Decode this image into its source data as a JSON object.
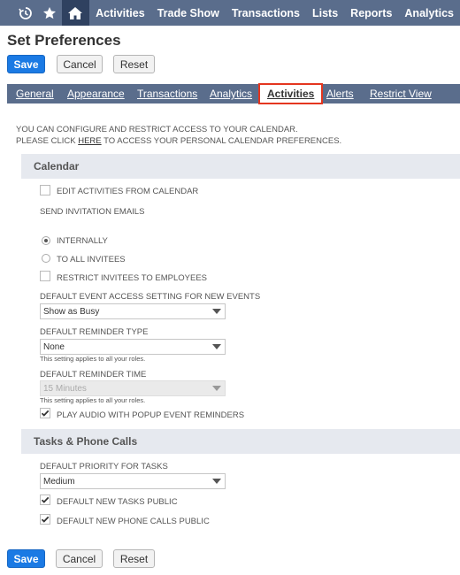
{
  "topnav": {
    "items": [
      "Activities",
      "Trade Show",
      "Transactions",
      "Lists",
      "Reports",
      "Analytics"
    ],
    "icons": [
      "history-icon",
      "star-icon",
      "home-icon"
    ]
  },
  "page": {
    "title": "Set Preferences"
  },
  "buttons": {
    "save": "Save",
    "cancel": "Cancel",
    "reset": "Reset"
  },
  "subtabs": [
    "General",
    "Appearance",
    "Transactions",
    "Analytics",
    "Activities",
    "Alerts",
    "Restrict View"
  ],
  "active_subtab": "Activities",
  "intro": {
    "line1": "YOU CAN CONFIGURE AND RESTRICT ACCESS TO YOUR CALENDAR.",
    "line2_pre": "PLEASE CLICK ",
    "line2_link": "HERE",
    "line2_post": " TO ACCESS YOUR PERSONAL CALENDAR PREFERENCES."
  },
  "calendar": {
    "header": "Calendar",
    "edit_activities": {
      "label": "EDIT ACTIVITIES FROM CALENDAR",
      "checked": false
    },
    "send_invitations_label": "SEND INVITATION EMAILS",
    "internally": {
      "label": "INTERNALLY",
      "selected": true
    },
    "to_all_invitees": {
      "label": "TO ALL INVITEES",
      "selected": false
    },
    "restrict_invitees": {
      "label": "RESTRICT INVITEES TO EMPLOYEES",
      "checked": false
    },
    "default_event_access": {
      "label": "DEFAULT EVENT ACCESS SETTING FOR NEW EVENTS",
      "value": "Show as Busy"
    },
    "default_reminder_type": {
      "label": "DEFAULT REMINDER TYPE",
      "value": "None",
      "hint": "This setting applies to all your roles."
    },
    "default_reminder_time": {
      "label": "DEFAULT REMINDER TIME",
      "value": "15 Minutes",
      "hint": "This setting applies to all your roles."
    },
    "play_audio": {
      "label": "PLAY AUDIO WITH POPUP EVENT REMINDERS",
      "checked": true
    }
  },
  "tasks": {
    "header": "Tasks & Phone Calls",
    "default_priority": {
      "label": "DEFAULT PRIORITY FOR TASKS",
      "value": "Medium"
    },
    "tasks_public": {
      "label": "DEFAULT NEW TASKS PUBLIC",
      "checked": true
    },
    "calls_public": {
      "label": "DEFAULT NEW PHONE CALLS PUBLIC",
      "checked": true
    }
  },
  "colors": {
    "nav_bg": "#5a6d8c",
    "home_bg": "#2f4160",
    "primary": "#1b7ae4",
    "active_tab_border": "#e4361f",
    "section_bg": "#e6e9ef"
  }
}
